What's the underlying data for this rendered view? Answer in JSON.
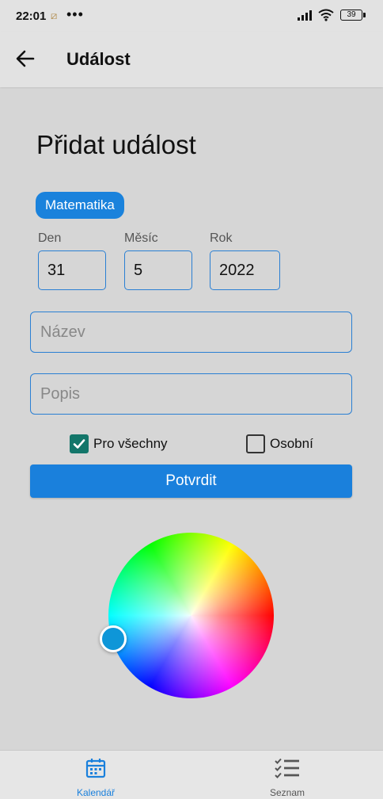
{
  "status_bar": {
    "time": "22:01",
    "misc": "⧄",
    "dots": "•••",
    "battery": "39"
  },
  "app_bar": {
    "title": "Událost",
    "back_icon": "arrow-left-icon"
  },
  "form": {
    "heading": "Přidat událost",
    "subject_chip": "Matematika",
    "date": {
      "day_label": "Den",
      "day_value": "31",
      "month_label": "Měsíc",
      "month_value": "5",
      "year_label": "Rok",
      "year_value": "2022"
    },
    "name_placeholder": "Název",
    "description_placeholder": "Popis",
    "checkbox_everyone": {
      "label": "Pro všechny",
      "checked": true
    },
    "checkbox_personal": {
      "label": "Osobní",
      "checked": false
    },
    "confirm_label": "Potvrdit"
  },
  "color_picker": {
    "selected_color": "#0e96d8"
  },
  "bottom_nav": {
    "items": [
      {
        "label": "Kalendář",
        "icon": "calendar-icon",
        "active": true,
        "color": "#1a80dc"
      },
      {
        "label": "Seznam",
        "icon": "checklist-icon",
        "active": false,
        "color": "#555555"
      }
    ]
  },
  "colors": {
    "accent": "#1a80dc",
    "checkbox_checked": "#13766a",
    "background": "#d6d6d6"
  }
}
